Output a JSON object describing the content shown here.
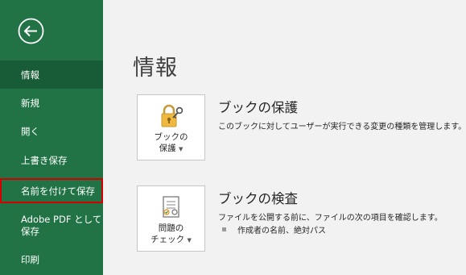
{
  "sidebar": {
    "back_icon": "back-arrow-icon",
    "items": [
      {
        "label": "情報"
      },
      {
        "label": "新規"
      },
      {
        "label": "開く"
      },
      {
        "label": "上書き保存"
      },
      {
        "label": "名前を付けて保存"
      },
      {
        "label_line1": "Adobe PDF として",
        "label_line2": "保存"
      },
      {
        "label": "印刷"
      }
    ]
  },
  "main": {
    "title": "情報",
    "protect": {
      "icon": "lock-key-icon",
      "button_line1": "ブックの",
      "button_line2": "保護",
      "title": "ブックの保護",
      "description": "このブックに対してユーザーが実行できる変更の種類を管理します。"
    },
    "inspect": {
      "icon": "inspect-document-icon",
      "button_line1": "問題の",
      "button_line2": "チェック",
      "title": "ブックの検査",
      "description": "ファイルを公開する前に、ファイルの次の項目を確認します。",
      "bullets": [
        "作成者の名前、絶対パス"
      ]
    }
  },
  "colors": {
    "sidebar_bg": "#217346",
    "sidebar_selected": "#185c37",
    "highlight_border": "#d40000",
    "content_bg": "#f2f2f2"
  }
}
